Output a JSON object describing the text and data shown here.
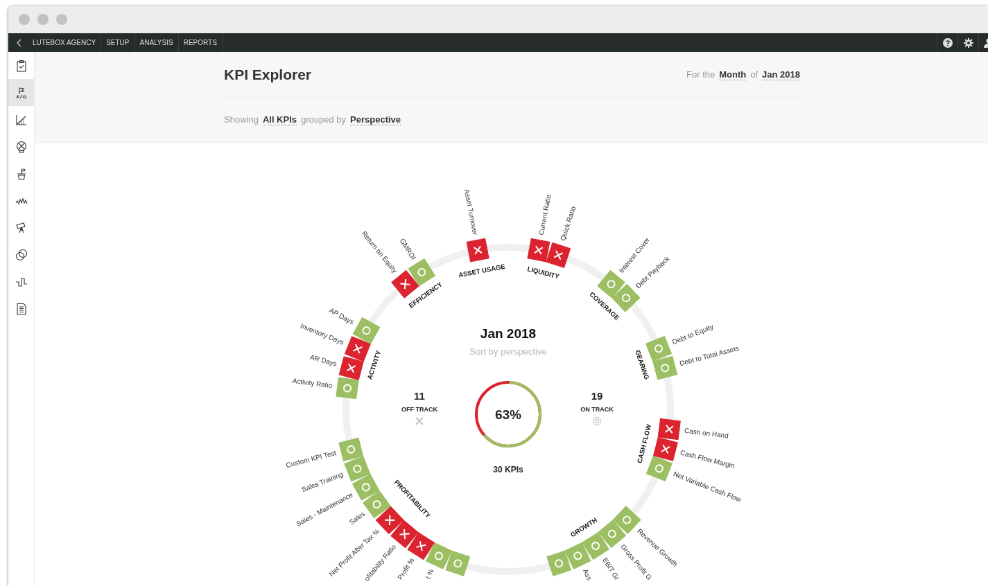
{
  "nav": {
    "items": [
      {
        "label": "LUTEBOX AGENCY"
      },
      {
        "label": "SETUP"
      },
      {
        "label": "ANALYSIS"
      },
      {
        "label": "REPORTS"
      }
    ]
  },
  "sidebar": {
    "items": [
      {
        "selected": false
      },
      {
        "selected": true
      },
      {
        "selected": false
      },
      {
        "selected": false
      },
      {
        "selected": false
      },
      {
        "selected": false
      },
      {
        "selected": false
      },
      {
        "selected": false
      },
      {
        "selected": false
      },
      {
        "selected": false
      }
    ]
  },
  "header": {
    "title": "KPI Explorer",
    "period_prefix": "For the",
    "period": "Month",
    "period_joiner": "of",
    "date": "Jan 2018"
  },
  "filter": {
    "prefix": "Showing",
    "scope": "All KPIs",
    "joiner": "grouped by",
    "grouping": "Perspective"
  },
  "summary": {
    "date": "Jan 2018",
    "sort_hint": "Sort by perspective",
    "off_track_count": "11",
    "off_track_label": "OFF TRACK",
    "on_track_count": "19",
    "on_track_label": "ON TRACK",
    "percent": "63%",
    "total": "30 KPIs"
  },
  "perspectives": [
    {
      "name": "EFFICIENCY",
      "kpis": [
        {
          "name": "Return on Equity",
          "on_track": false
        },
        {
          "name": "GMROI",
          "on_track": true
        }
      ]
    },
    {
      "name": "ASSET USAGE",
      "kpis": [
        {
          "name": "Asset Turnover",
          "on_track": false
        }
      ]
    },
    {
      "name": "LIQUIDITY",
      "kpis": [
        {
          "name": "Current Ratio",
          "on_track": false
        },
        {
          "name": "Quick Ratio",
          "on_track": false
        }
      ]
    },
    {
      "name": "COVERAGE",
      "kpis": [
        {
          "name": "Interest Cover",
          "on_track": true
        },
        {
          "name": "Debt Payback",
          "on_track": true
        }
      ]
    },
    {
      "name": "GEARING",
      "kpis": [
        {
          "name": "Debt to Equity",
          "on_track": true
        },
        {
          "name": "Debt to Total Assets",
          "on_track": true
        }
      ]
    },
    {
      "name": "CASH FLOW",
      "kpis": [
        {
          "name": "Cash on Hand",
          "on_track": false
        },
        {
          "name": "Cash Flow Margin",
          "on_track": false
        },
        {
          "name": "Net Variable Cash Flow",
          "on_track": true
        }
      ]
    },
    {
      "name": "GROWTH",
      "kpis": [
        {
          "name": "Revenue Growth",
          "on_track": true
        },
        {
          "name": "Gross Profit G",
          "on_track": true
        },
        {
          "name": "EBIT Gr",
          "on_track": true
        },
        {
          "name": "Ass",
          "on_track": true
        },
        {
          "on_track": true
        }
      ]
    },
    {
      "name": "PROFITABILITY",
      "kpis": [
        {
          "on_track": true
        },
        {
          "name": "t %",
          "on_track": true
        },
        {
          "name": "Profit %",
          "on_track": false
        },
        {
          "name": "ofitability Ratio",
          "on_track": false
        },
        {
          "name": "Net Profit After Tax %",
          "on_track": false
        },
        {
          "name": "Sales",
          "on_track": true
        },
        {
          "name": "Sales - Maintenance",
          "on_track": true
        },
        {
          "name": "Sales Training",
          "on_track": true
        },
        {
          "name": "Custom KPI Test",
          "on_track": true
        }
      ]
    },
    {
      "name": "ACTIVITY",
      "kpis": [
        {
          "name": "Activity Ratio",
          "on_track": true
        },
        {
          "name": "AR Days",
          "on_track": false
        },
        {
          "name": "Inventory Days",
          "on_track": false
        },
        {
          "name": "AP Days",
          "on_track": true
        }
      ]
    }
  ]
}
